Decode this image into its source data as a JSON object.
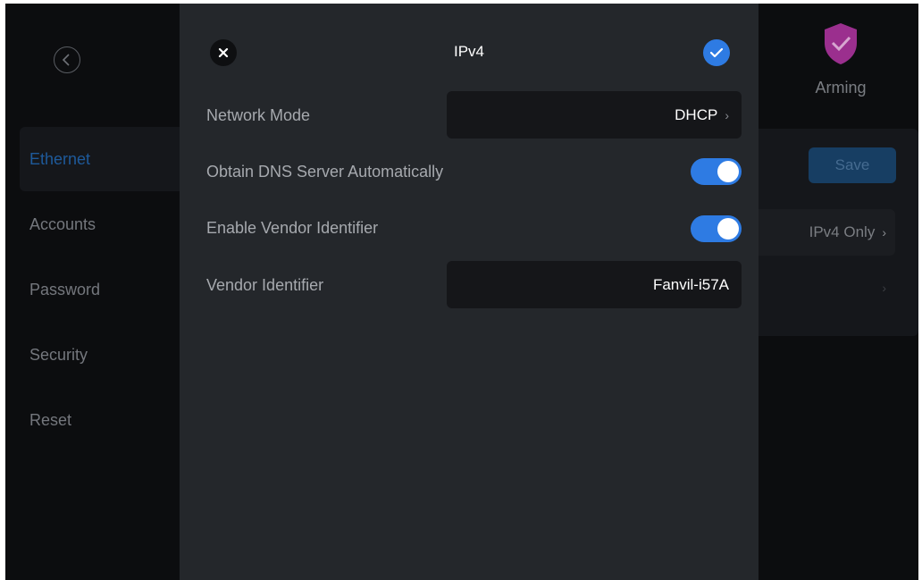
{
  "sidebar": {
    "items": [
      {
        "label": "Ethernet",
        "active": true
      },
      {
        "label": "Accounts",
        "active": false
      },
      {
        "label": "Password",
        "active": false
      },
      {
        "label": "Security",
        "active": false
      },
      {
        "label": "Reset",
        "active": false
      }
    ]
  },
  "header": {
    "arming_label": "Arming",
    "arming_color": "#9b2f8e"
  },
  "background": {
    "save_label": "Save",
    "ip_mode_value": "IPv4 Only"
  },
  "modal": {
    "title": "IPv4",
    "rows": {
      "network_mode_label": "Network Mode",
      "network_mode_value": "DHCP",
      "obtain_dns_label": "Obtain DNS Server Automatically",
      "obtain_dns_enabled": true,
      "enable_vendor_label": "Enable Vendor Identifier",
      "enable_vendor_enabled": true,
      "vendor_identifier_label": "Vendor Identifier",
      "vendor_identifier_value": "Fanvil-i57A"
    }
  },
  "colors": {
    "accent": "#2e7be3",
    "active_nav_text": "#1e5a9b"
  }
}
